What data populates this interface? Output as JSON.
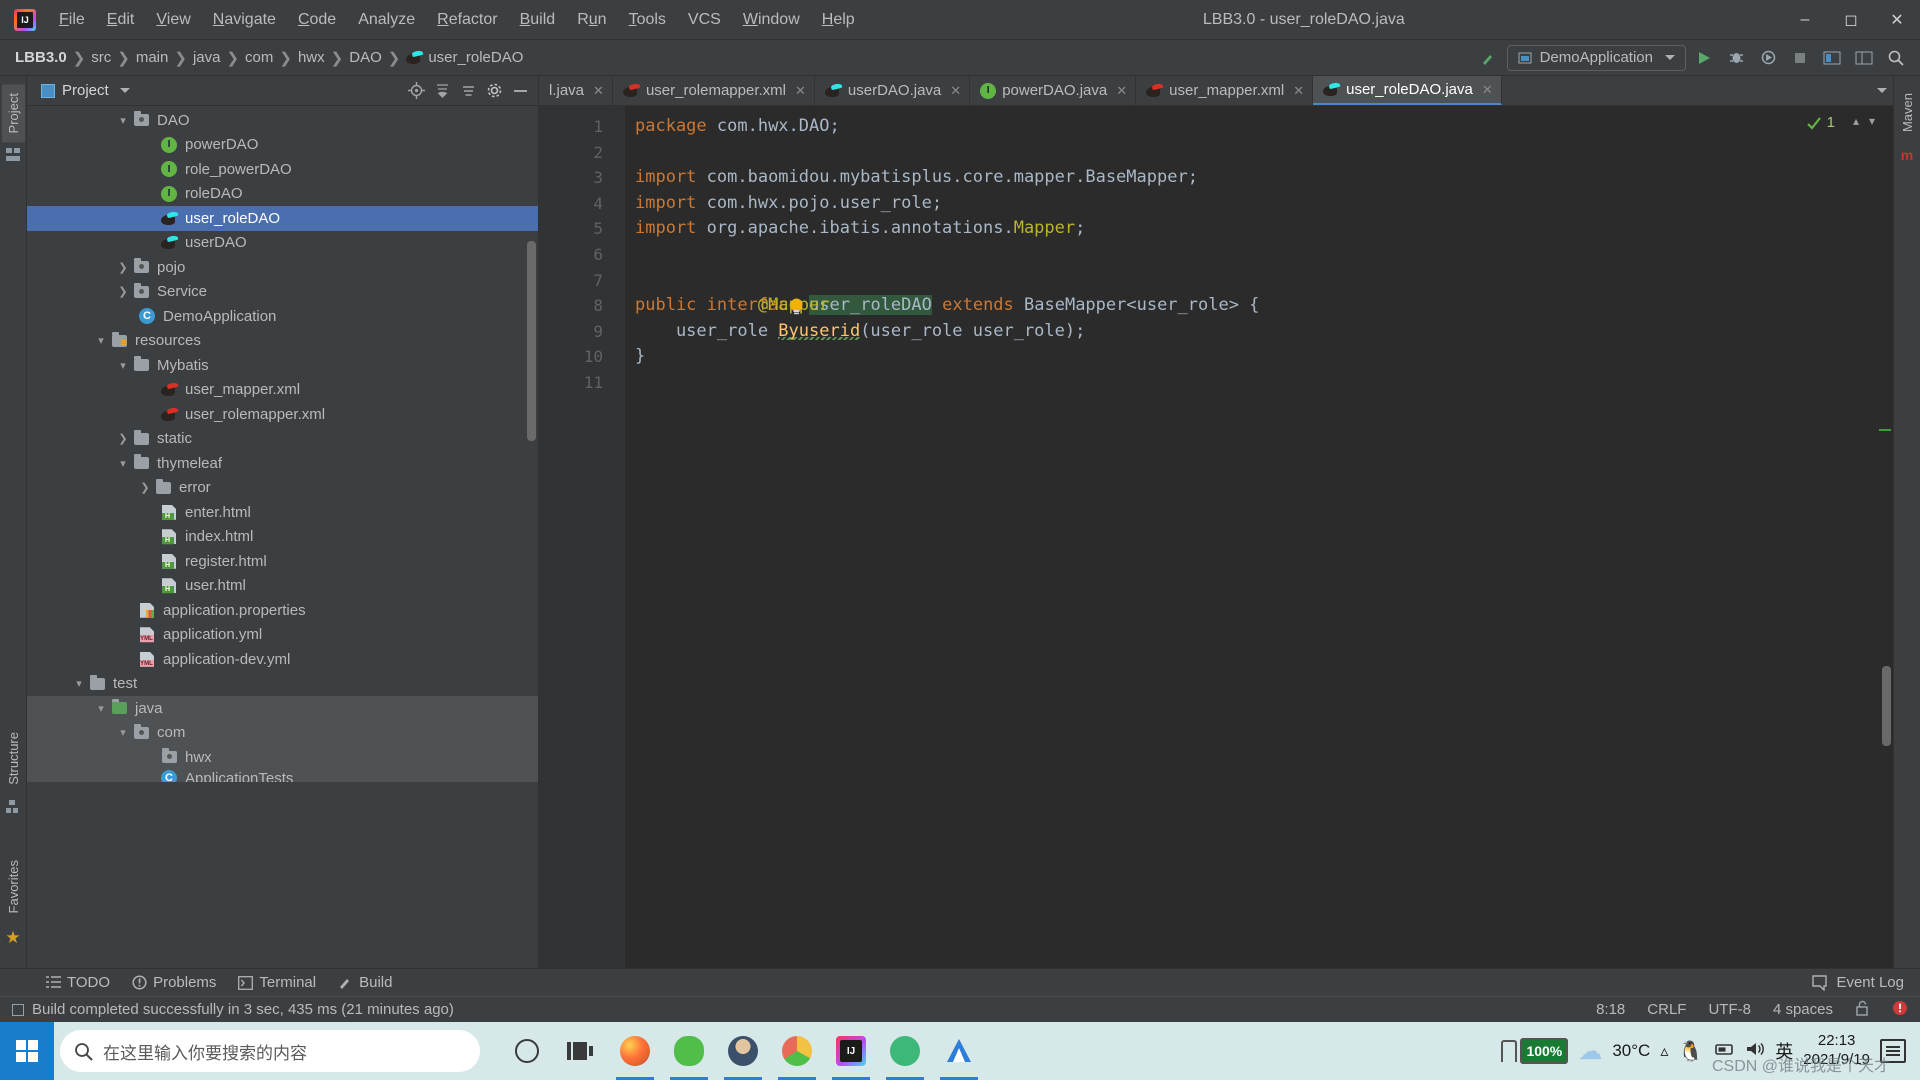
{
  "window": {
    "title": "LBB3.0 - user_roleDAO.java",
    "logo_icon": "intellij-idea-logo",
    "minimize_icon": "minimize-icon",
    "maximize_icon": "maximize-icon",
    "close_icon": "close-icon"
  },
  "menubar": {
    "items": [
      {
        "label": "File",
        "mnemonic": "F"
      },
      {
        "label": "Edit",
        "mnemonic": "E"
      },
      {
        "label": "View",
        "mnemonic": "V"
      },
      {
        "label": "Navigate",
        "mnemonic": "N"
      },
      {
        "label": "Code",
        "mnemonic": "C"
      },
      {
        "label": "Analyze",
        "mnemonic": ""
      },
      {
        "label": "Refactor",
        "mnemonic": "R"
      },
      {
        "label": "Build",
        "mnemonic": "B"
      },
      {
        "label": "Run",
        "mnemonic": "u"
      },
      {
        "label": "Tools",
        "mnemonic": "T"
      },
      {
        "label": "VCS",
        "mnemonic": ""
      },
      {
        "label": "Window",
        "mnemonic": "W"
      },
      {
        "label": "Help",
        "mnemonic": "H"
      }
    ]
  },
  "breadcrumb": {
    "items": [
      "LBB3.0",
      "src",
      "main",
      "java",
      "com",
      "hwx",
      "DAO",
      "user_roleDAO"
    ],
    "separator": "›"
  },
  "toolbar": {
    "build_icon": "hammer-icon",
    "run_config": "DemoApplication",
    "run_icon": "run-icon",
    "debug_icon": "debug-icon",
    "run_coverage_icon": "run-with-coverage-icon",
    "stop_icon": "stop-icon",
    "updates_icon": "updates-icon",
    "layout_icon": "layout-icon",
    "search_icon": "search-everywhere-icon"
  },
  "left_strip": {
    "tabs": [
      "Project",
      "Structure",
      "Favorites"
    ],
    "active": "Project",
    "star_icon": "star-icon",
    "structure_icon": "structure-icon"
  },
  "right_strip": {
    "tabs": [
      "Maven"
    ]
  },
  "project_panel": {
    "title": "Project",
    "title_icon": "project-view-icon",
    "tools": [
      "locate-icon",
      "expand-all-icon",
      "collapse-all-icon",
      "settings-gear-icon",
      "hide-icon"
    ],
    "tree": [
      {
        "label": "DAO",
        "indent": 5,
        "arrow": "down",
        "icon": "folder-package"
      },
      {
        "label": "powerDAO",
        "indent": 7,
        "arrow": "",
        "icon": "interface"
      },
      {
        "label": "role_powerDAO",
        "indent": 7,
        "arrow": "",
        "icon": "interface"
      },
      {
        "label": "roleDAO",
        "indent": 7,
        "arrow": "",
        "icon": "interface"
      },
      {
        "label": "user_roleDAO",
        "indent": 7,
        "arrow": "",
        "icon": "mybatis-mapper",
        "selected": true
      },
      {
        "label": "userDAO",
        "indent": 7,
        "arrow": "",
        "icon": "mybatis-mapper"
      },
      {
        "label": "pojo",
        "indent": 5,
        "arrow": "right",
        "icon": "folder-package"
      },
      {
        "label": "Service",
        "indent": 5,
        "arrow": "right",
        "icon": "folder-package"
      },
      {
        "label": "DemoApplication",
        "indent": 6,
        "arrow": "",
        "icon": "spring-boot"
      },
      {
        "label": "resources",
        "indent": 3,
        "arrow": "down",
        "icon": "folder-resources"
      },
      {
        "label": "Mybatis",
        "indent": 4,
        "arrow": "down",
        "icon": "folder"
      },
      {
        "label": "user_mapper.xml",
        "indent": 6,
        "arrow": "",
        "icon": "mybatis-xml"
      },
      {
        "label": "user_rolemapper.xml",
        "indent": 6,
        "arrow": "",
        "icon": "mybatis-xml"
      },
      {
        "label": "static",
        "indent": 4,
        "arrow": "right",
        "icon": "folder"
      },
      {
        "label": "thymeleaf",
        "indent": 4,
        "arrow": "down",
        "icon": "folder"
      },
      {
        "label": "error",
        "indent": 5,
        "arrow": "right",
        "icon": "folder"
      },
      {
        "label": "enter.html",
        "indent": 6,
        "arrow": "",
        "icon": "html-file"
      },
      {
        "label": "index.html",
        "indent": 6,
        "arrow": "",
        "icon": "html-file"
      },
      {
        "label": "register.html",
        "indent": 6,
        "arrow": "",
        "icon": "html-file"
      },
      {
        "label": "user.html",
        "indent": 6,
        "arrow": "",
        "icon": "html-file"
      },
      {
        "label": "application.properties",
        "indent": 5,
        "arrow": "",
        "icon": "properties-file"
      },
      {
        "label": "application.yml",
        "indent": 5,
        "arrow": "",
        "icon": "yml-file"
      },
      {
        "label": "application-dev.yml",
        "indent": 5,
        "arrow": "",
        "icon": "yml-file"
      },
      {
        "label": "test",
        "indent": 2,
        "arrow": "down",
        "icon": "folder"
      },
      {
        "label": "java",
        "indent": 3,
        "arrow": "down",
        "icon": "folder-test-source",
        "hover": true
      },
      {
        "label": "com",
        "indent": 4,
        "arrow": "down",
        "icon": "folder-package",
        "hover": true
      },
      {
        "label": "hwx",
        "indent": 5,
        "arrow": "",
        "icon": "folder-package",
        "hover": true
      },
      {
        "label": "ApplicationTests",
        "indent": 6,
        "arrow": "",
        "icon": "spring-boot",
        "hover": true
      }
    ]
  },
  "editor_tabs": {
    "items": [
      {
        "label": "l.java",
        "icon": "java-file",
        "active": false,
        "clipped": true
      },
      {
        "label": "user_rolemapper.xml",
        "icon": "mybatis-xml",
        "active": false
      },
      {
        "label": "userDAO.java",
        "icon": "mybatis-mapper",
        "active": false
      },
      {
        "label": "powerDAO.java",
        "icon": "interface",
        "active": false
      },
      {
        "label": "user_mapper.xml",
        "icon": "mybatis-xml",
        "active": false
      },
      {
        "label": "user_roleDAO.java",
        "icon": "mybatis-mapper",
        "active": true
      }
    ],
    "close_icon": "close-tab-icon",
    "overflow_icon": "chevron-down-icon"
  },
  "editor": {
    "inspection_status": "1",
    "inspection_icon": "inspection-ok-icon",
    "up_icon": "previous-highlight-icon",
    "down_icon": "next-highlight-icon",
    "line_numbers": [
      "1",
      "2",
      "3",
      "4",
      "5",
      "6",
      "7",
      "8",
      "9",
      "10",
      "11"
    ],
    "lines": [
      {
        "n": 1,
        "tokens": [
          {
            "t": "package",
            "c": "kw"
          },
          {
            "t": " com.hwx.DAO",
            "c": "pl"
          },
          {
            "t": ";",
            "c": "pl"
          }
        ]
      },
      {
        "n": 2,
        "tokens": []
      },
      {
        "n": 3,
        "tokens": [
          {
            "t": "import",
            "c": "kw"
          },
          {
            "t": " com.baomidou.mybatisplus.core.mapper.BaseMapper;",
            "c": "pl"
          }
        ],
        "fold": "minus"
      },
      {
        "n": 4,
        "tokens": [
          {
            "t": "import",
            "c": "kw"
          },
          {
            "t": " com.hwx.pojo.user_role;",
            "c": "pl"
          }
        ]
      },
      {
        "n": 5,
        "tokens": [
          {
            "t": "import",
            "c": "kw"
          },
          {
            "t": " org.apache.ibatis.annotations.",
            "c": "pl"
          },
          {
            "t": "Mapper",
            "c": "ann"
          },
          {
            "t": ";",
            "c": "pl"
          }
        ],
        "fold": "end"
      },
      {
        "n": 6,
        "tokens": []
      },
      {
        "n": 7,
        "tokens": [
          {
            "t": "@Mapper",
            "c": "ann"
          }
        ],
        "bulb": true
      },
      {
        "n": 8,
        "tokens": [
          {
            "t": "public",
            "c": "kw"
          },
          {
            "t": " ",
            "c": "pl"
          },
          {
            "t": "interface",
            "c": "kw"
          },
          {
            "t": " ",
            "c": "pl"
          },
          {
            "t": "user_roleDAO",
            "c": "pl strh"
          },
          {
            "t": " ",
            "c": "pl"
          },
          {
            "t": "extends",
            "c": "kw"
          },
          {
            "t": " BaseMapper<user_role> {",
            "c": "pl"
          }
        ],
        "gutter_icon": "mybatis-mapper"
      },
      {
        "n": 9,
        "tokens": [
          {
            "t": "    user_role ",
            "c": "pl"
          },
          {
            "t": "Byuserid",
            "c": "meth"
          },
          {
            "t": "(user_role user_role);",
            "c": "pl"
          }
        ],
        "gutter_icon": "mybatis-mapper"
      },
      {
        "n": 10,
        "tokens": [
          {
            "t": "}",
            "c": "pl"
          }
        ]
      },
      {
        "n": 11,
        "tokens": []
      }
    ]
  },
  "bottom_tools": {
    "items": [
      {
        "label": "TODO",
        "icon": "todo-icon"
      },
      {
        "label": "Problems",
        "icon": "problems-icon"
      },
      {
        "label": "Terminal",
        "icon": "terminal-icon"
      },
      {
        "label": "Build",
        "icon": "build-hammer-icon"
      }
    ],
    "event_log": "Event Log",
    "event_log_icon": "event-log-icon"
  },
  "statusbar": {
    "message": "Build completed successfully in 3 sec, 435 ms (21 minutes ago)",
    "message_icon": "build-status-icon",
    "caret": "8:18",
    "line_separator": "CRLF",
    "encoding": "UTF-8",
    "indent": "4 spaces",
    "lock_icon": "unlocked-icon",
    "error_icon": "error-badge-icon"
  },
  "taskbar": {
    "start_icon": "windows-start-icon",
    "search_placeholder": "在这里输入你要搜索的内容",
    "search_icon": "search-icon",
    "icons": [
      {
        "name": "cortana-icon",
        "color": "#ffffff"
      },
      {
        "name": "task-view-icon",
        "color": "#333333"
      },
      {
        "name": "firefox-icon",
        "color": "#e8622b",
        "active": true
      },
      {
        "name": "wechat-icon",
        "color": "#4fbf4a",
        "active": true
      },
      {
        "name": "user-avatar-icon",
        "color": "#3a506b",
        "active": true
      },
      {
        "name": "chrome-icon",
        "color": "#f4c242",
        "active": true
      },
      {
        "name": "intellij-icon",
        "color": "#2b2b6b",
        "active": true
      },
      {
        "name": "app-green-icon",
        "color": "#3cb878",
        "active": true
      },
      {
        "name": "app-blue-icon",
        "color": "#2d7ed8",
        "active": true
      }
    ],
    "battery": "100%",
    "weather": "30°C",
    "weather_icon": "cloud-icon",
    "chevron_icon": "chevron-up-icon",
    "qq_icon": "qq-penguin-icon",
    "network_icon": "network-icon",
    "volume_icon": "volume-icon",
    "ime": "英",
    "time": "22:13",
    "date": "2021/9/19",
    "notification_icon": "notification-icon",
    "watermark": "CSDN @谁说我是个天才"
  }
}
